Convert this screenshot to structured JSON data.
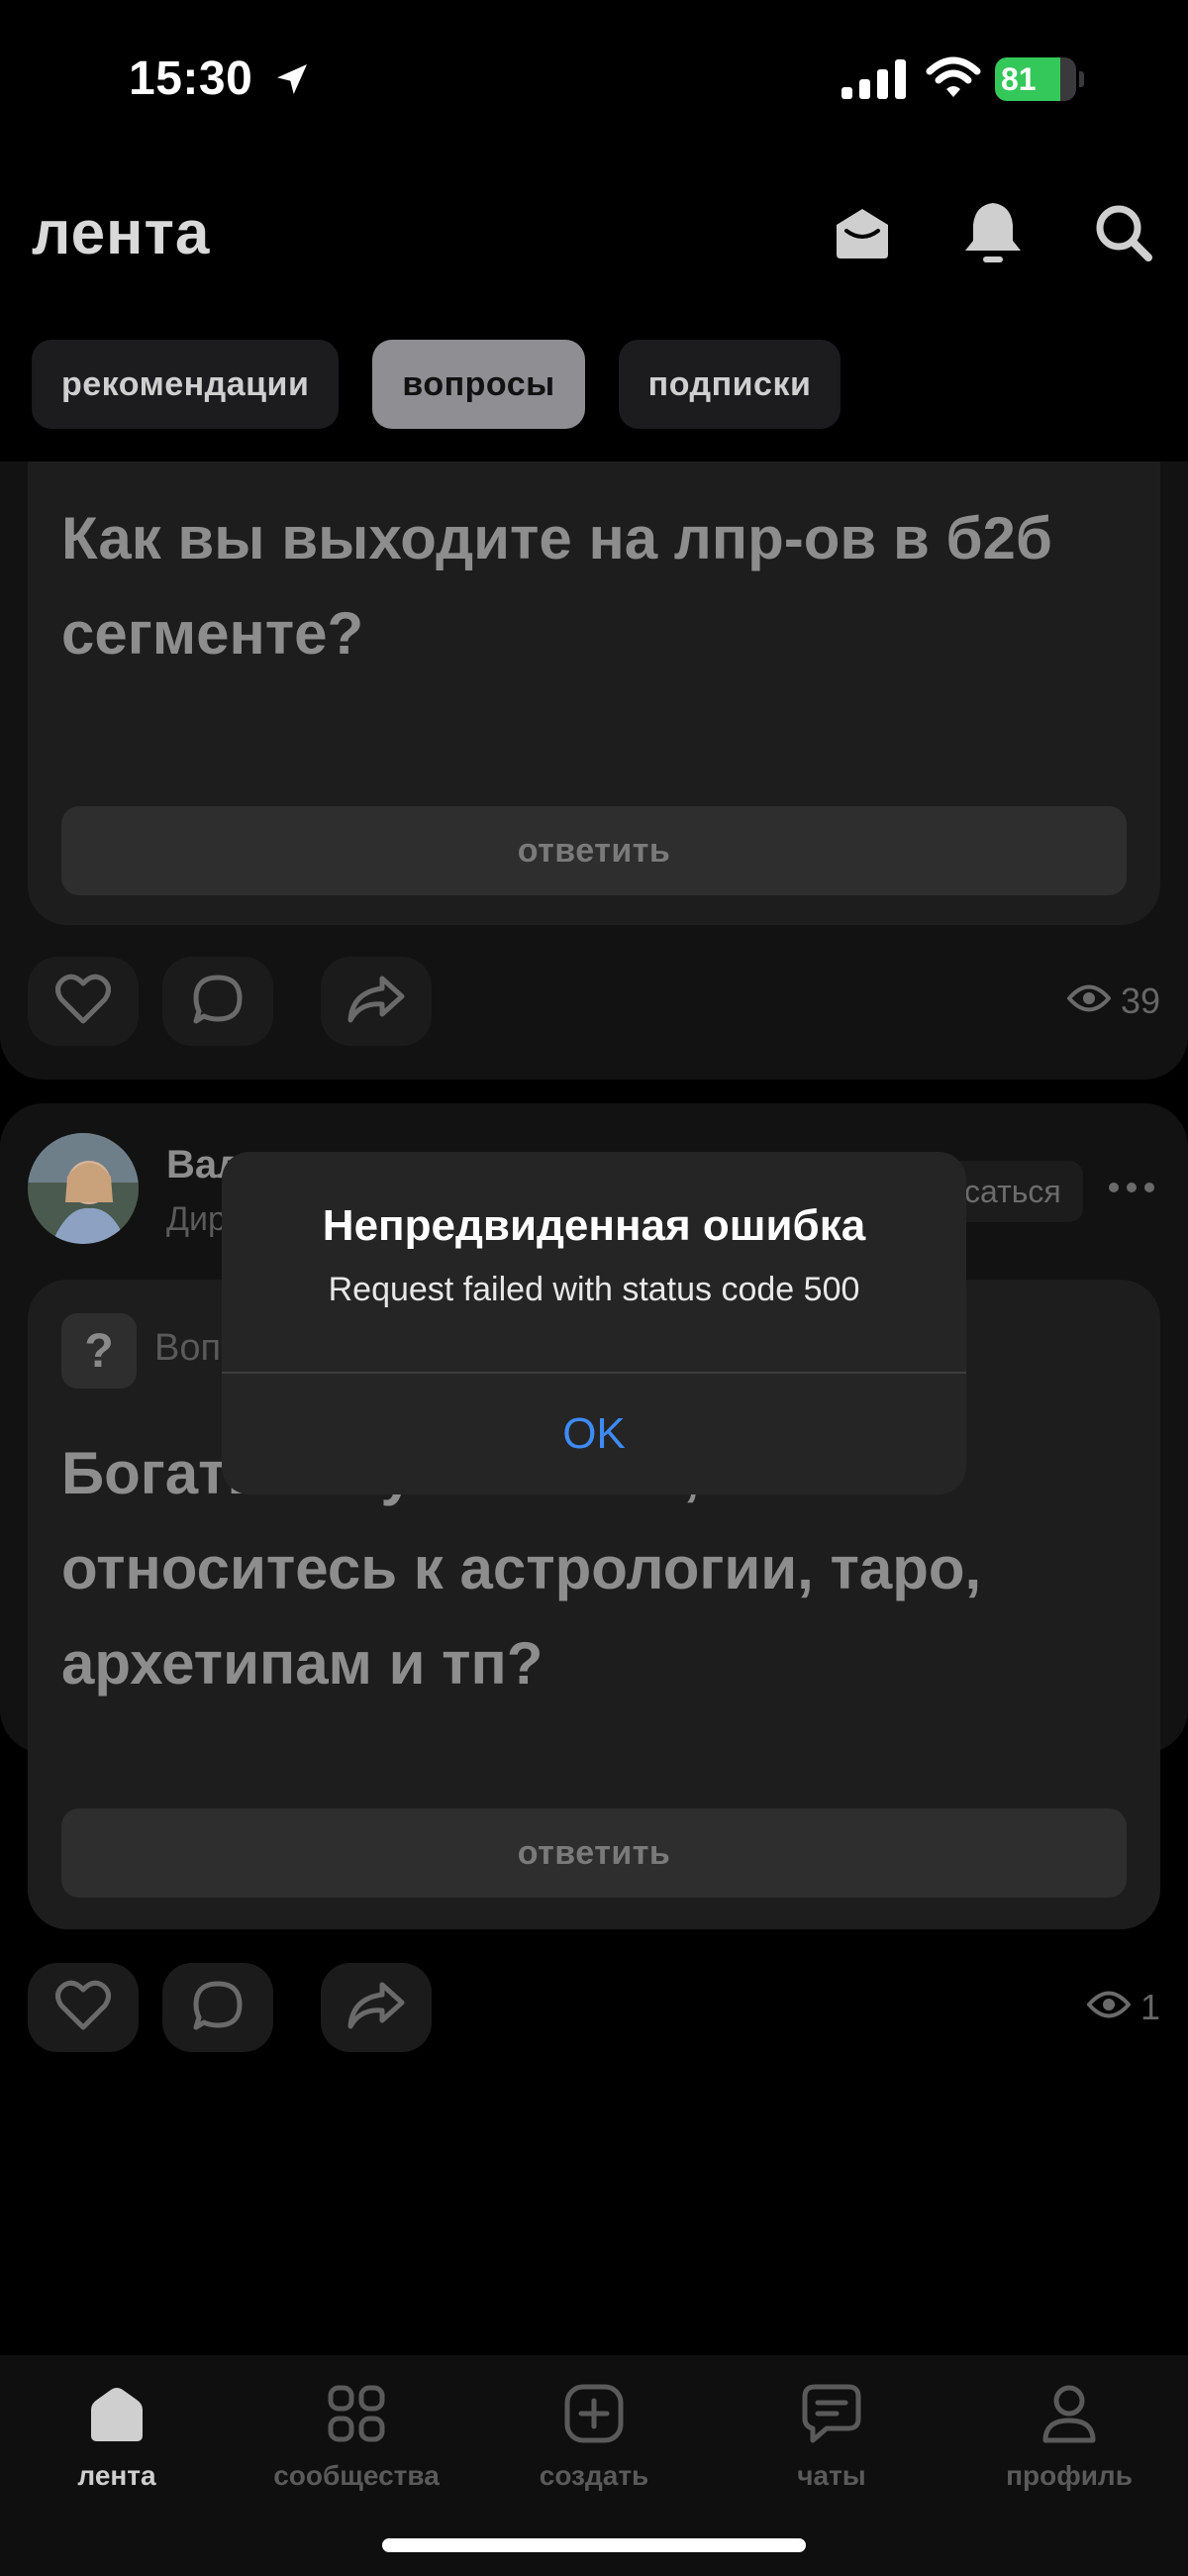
{
  "status_bar": {
    "time": "15:30",
    "battery": "81"
  },
  "header": {
    "logo": "лента"
  },
  "tabs": [
    {
      "label": "рекомендации",
      "active": false
    },
    {
      "label": "вопросы",
      "active": true
    },
    {
      "label": "подписки",
      "active": false
    }
  ],
  "posts": [
    {
      "question": "Как вы выходите на лпр-ов в б2б сегменте?",
      "answer_label": "ответить",
      "views": "39"
    },
    {
      "author": "Вал",
      "author_sub": "Дир",
      "subscribe_label": "саться",
      "question_label": "Воп",
      "question": "Богатые и успешные, как вы относитесь к астрологии, таро, архетипам и тп?",
      "answer_label": "ответить",
      "views": "1"
    }
  ],
  "alert": {
    "title": "Непредвиденная ошибка",
    "message": "Request failed with status code 500",
    "ok_label": "OK"
  },
  "tabbar": [
    {
      "label": "лента",
      "icon": "home-icon",
      "active": true
    },
    {
      "label": "сообщества",
      "icon": "grid-icon",
      "active": false
    },
    {
      "label": "создать",
      "icon": "plus-square-icon",
      "active": false
    },
    {
      "label": "чаты",
      "icon": "chat-icon",
      "active": false
    },
    {
      "label": "профиль",
      "icon": "profile-icon",
      "active": false
    }
  ],
  "colors": {
    "accent": "#3d8bf5",
    "battery": "#34c759",
    "background": "#000000"
  }
}
